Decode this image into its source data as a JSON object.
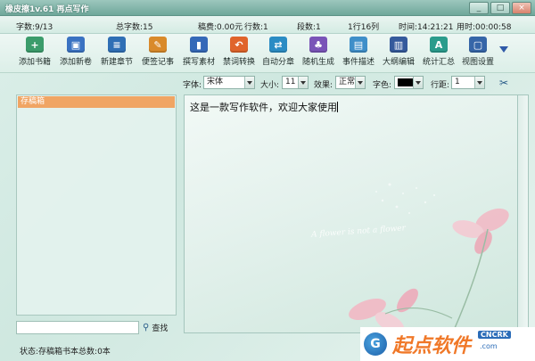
{
  "window": {
    "title": "橡皮擦1v.61 再点写作",
    "buttons": [
      "_",
      "□",
      "×"
    ]
  },
  "stats": {
    "chars": "字数:9/13",
    "total_chars": "总字数:15",
    "fee": "稿费:0.00元",
    "line": "行数:1",
    "paragraph": "段数:1",
    "position": "1行16列",
    "time": "时间:14:21:21",
    "used_time": "用时:00:00:58"
  },
  "toolbar": {
    "items": [
      {
        "label": "添加书籍",
        "icon": "add-book-icon",
        "color": "#3b9c6b",
        "glyph": "+"
      },
      {
        "label": "添加新卷",
        "icon": "add-volume-icon",
        "color": "#3a72c2",
        "glyph": "▣"
      },
      {
        "label": "新建章节",
        "icon": "new-chapter-icon",
        "color": "#2f6fb5",
        "glyph": "≡"
      },
      {
        "label": "便签记事",
        "icon": "note-icon",
        "color": "#d98a2b",
        "glyph": "✎"
      },
      {
        "label": "撰写素材",
        "icon": "material-icon",
        "color": "#3569b8",
        "glyph": "▮"
      },
      {
        "label": "禁词转换",
        "icon": "convert-icon",
        "color": "#e0642b",
        "glyph": "↶"
      },
      {
        "label": "自动分章",
        "icon": "split-chapter-icon",
        "color": "#2b8cc4",
        "glyph": "⇄"
      },
      {
        "label": "随机生成",
        "icon": "random-icon",
        "color": "#7a54b8",
        "glyph": "♣"
      },
      {
        "label": "事件描述",
        "icon": "event-icon",
        "color": "#3f8fc9",
        "glyph": "▤"
      },
      {
        "label": "大纲编辑",
        "icon": "outline-icon",
        "color": "#355a9c",
        "glyph": "▥"
      },
      {
        "label": "统计汇总",
        "icon": "stats-icon",
        "color": "#2a9c8c",
        "glyph": "A"
      },
      {
        "label": "视图设置",
        "icon": "view-settings-icon",
        "color": "#3666a8",
        "glyph": "▢"
      }
    ]
  },
  "format": {
    "font_label": "字体:",
    "font_value": "宋体",
    "size_label": "大小:",
    "size_value": "11",
    "effect_label": "效果:",
    "effect_value": "正常",
    "color_label": "字色:",
    "linespacing_label": "行距:",
    "linespacing_value": "1",
    "text_color": "#000000"
  },
  "sidebar": {
    "root_item": "存稿箱",
    "search_label": "查找"
  },
  "editor": {
    "content": "这是一款写作软件，欢迎大家使用",
    "decor_text": "A flower is not a flower"
  },
  "status": {
    "text": "状态:存稿箱书本总数:0本"
  },
  "watermark": {
    "logo": "G",
    "text": "起点软件",
    "badge": "CNCRK",
    "domain": ".com"
  }
}
